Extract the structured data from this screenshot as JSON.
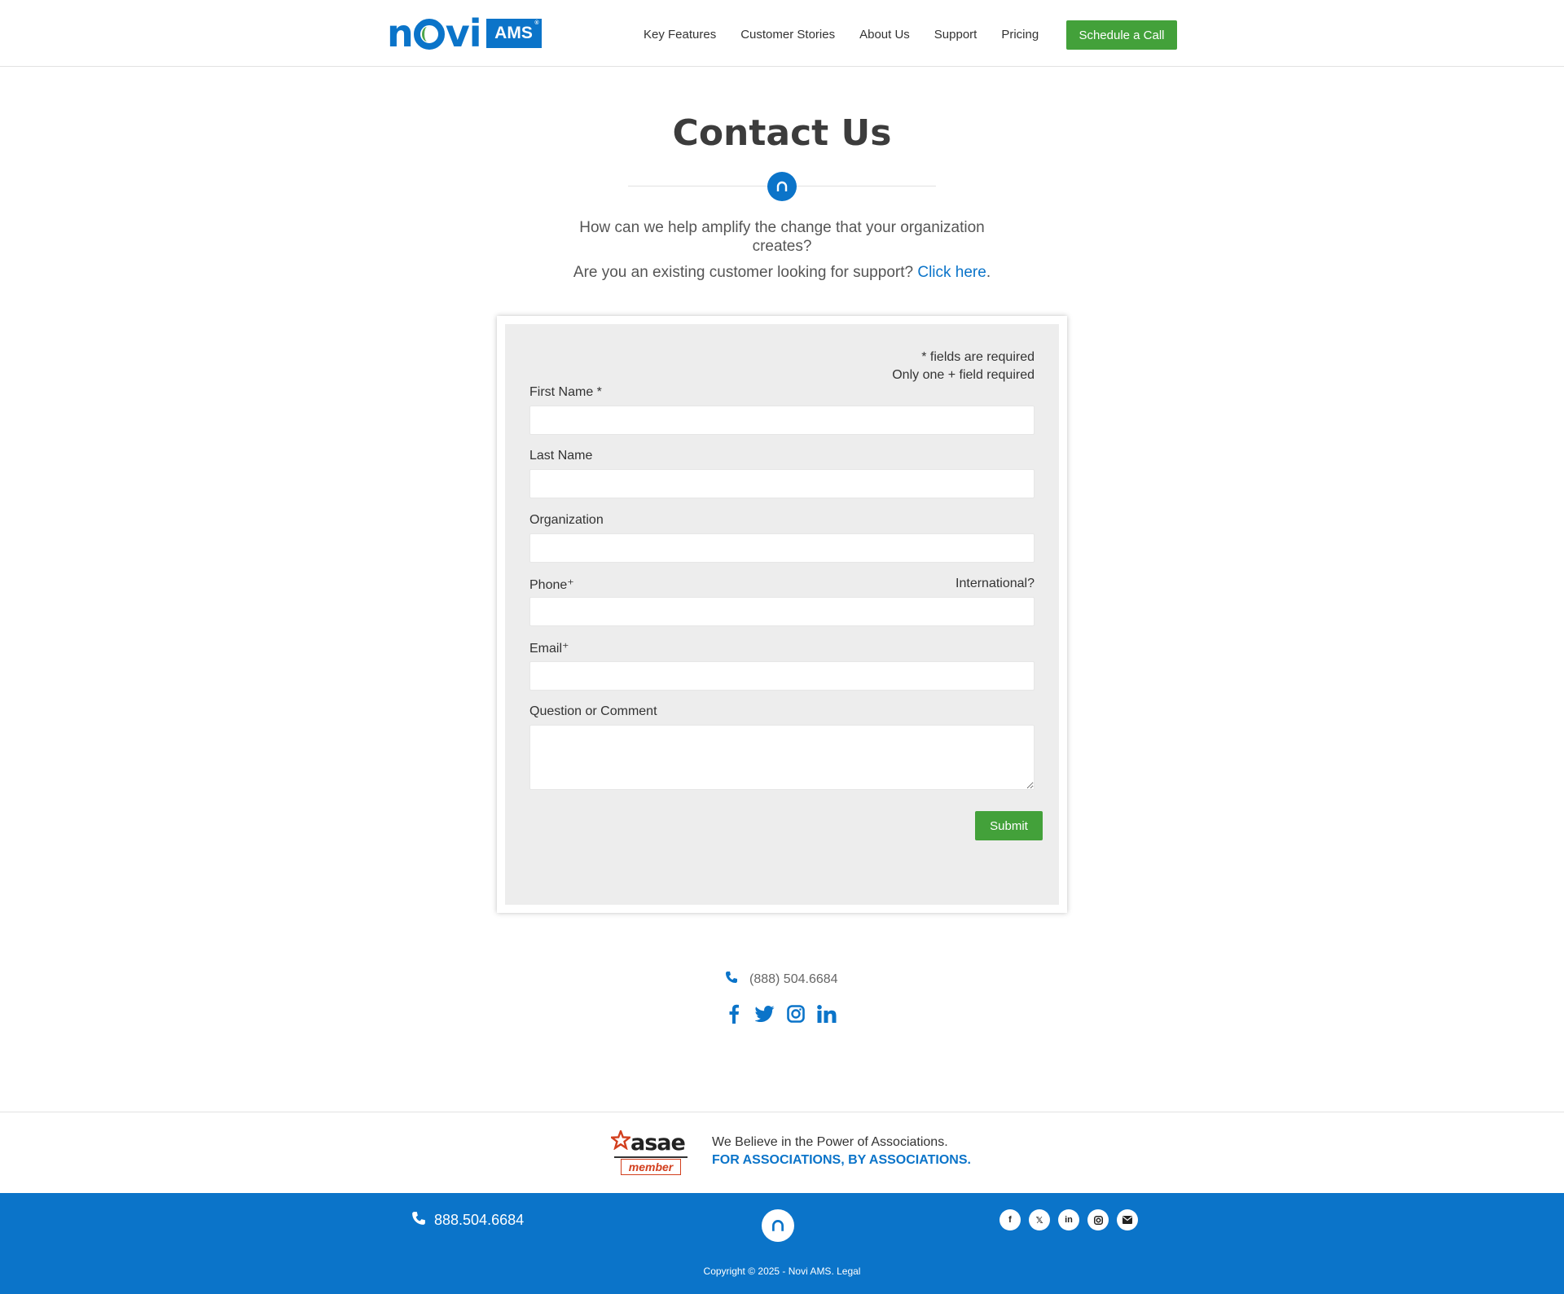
{
  "header": {
    "logo_text": "novi",
    "logo_badge": "AMS",
    "nav": [
      "Key Features",
      "Customer Stories",
      "About Us",
      "Support",
      "Pricing"
    ],
    "cta": "Schedule a Call"
  },
  "hero": {
    "title": "Contact Us",
    "lead": "How can we help amplify the change that your organization creates?",
    "support_prefix": "Are you an existing customer looking for support? ",
    "support_link": "Click here",
    "support_suffix": "."
  },
  "form": {
    "required_note_1": "* fields are required",
    "required_note_2": "Only one + field required",
    "first_name_label": "First Name *",
    "last_name_label": "Last Name",
    "organization_label": "Organization",
    "phone_label": "Phone⁺",
    "international_label": "International?",
    "email_label": "Email⁺",
    "comment_label": "Question or Comment",
    "first_name_value": "",
    "last_name_value": "",
    "organization_value": "",
    "phone_value": "",
    "email_value": "",
    "comment_value": "",
    "submit_label": "Submit"
  },
  "contact": {
    "phone": "(888) 504.6684",
    "socials": [
      "facebook-icon",
      "twitter-icon",
      "instagram-icon",
      "linkedin-icon"
    ]
  },
  "strip": {
    "asae_word": "asae",
    "asae_member": "member",
    "line1": "We Believe in the Power of Associations.",
    "line2": "FOR ASSOCIATIONS, BY ASSOCIATIONS."
  },
  "footer": {
    "phone": "888.504.6684",
    "socials": [
      "facebook-icon",
      "x-icon",
      "linkedin-icon",
      "instagram-icon",
      "email-icon"
    ],
    "copyright": "Copyright © 2025 - Novi AMS. Legal"
  },
  "colors": {
    "brand_blue": "#0b74c9",
    "cta_green": "#43a13a",
    "form_bg": "#ededed"
  }
}
